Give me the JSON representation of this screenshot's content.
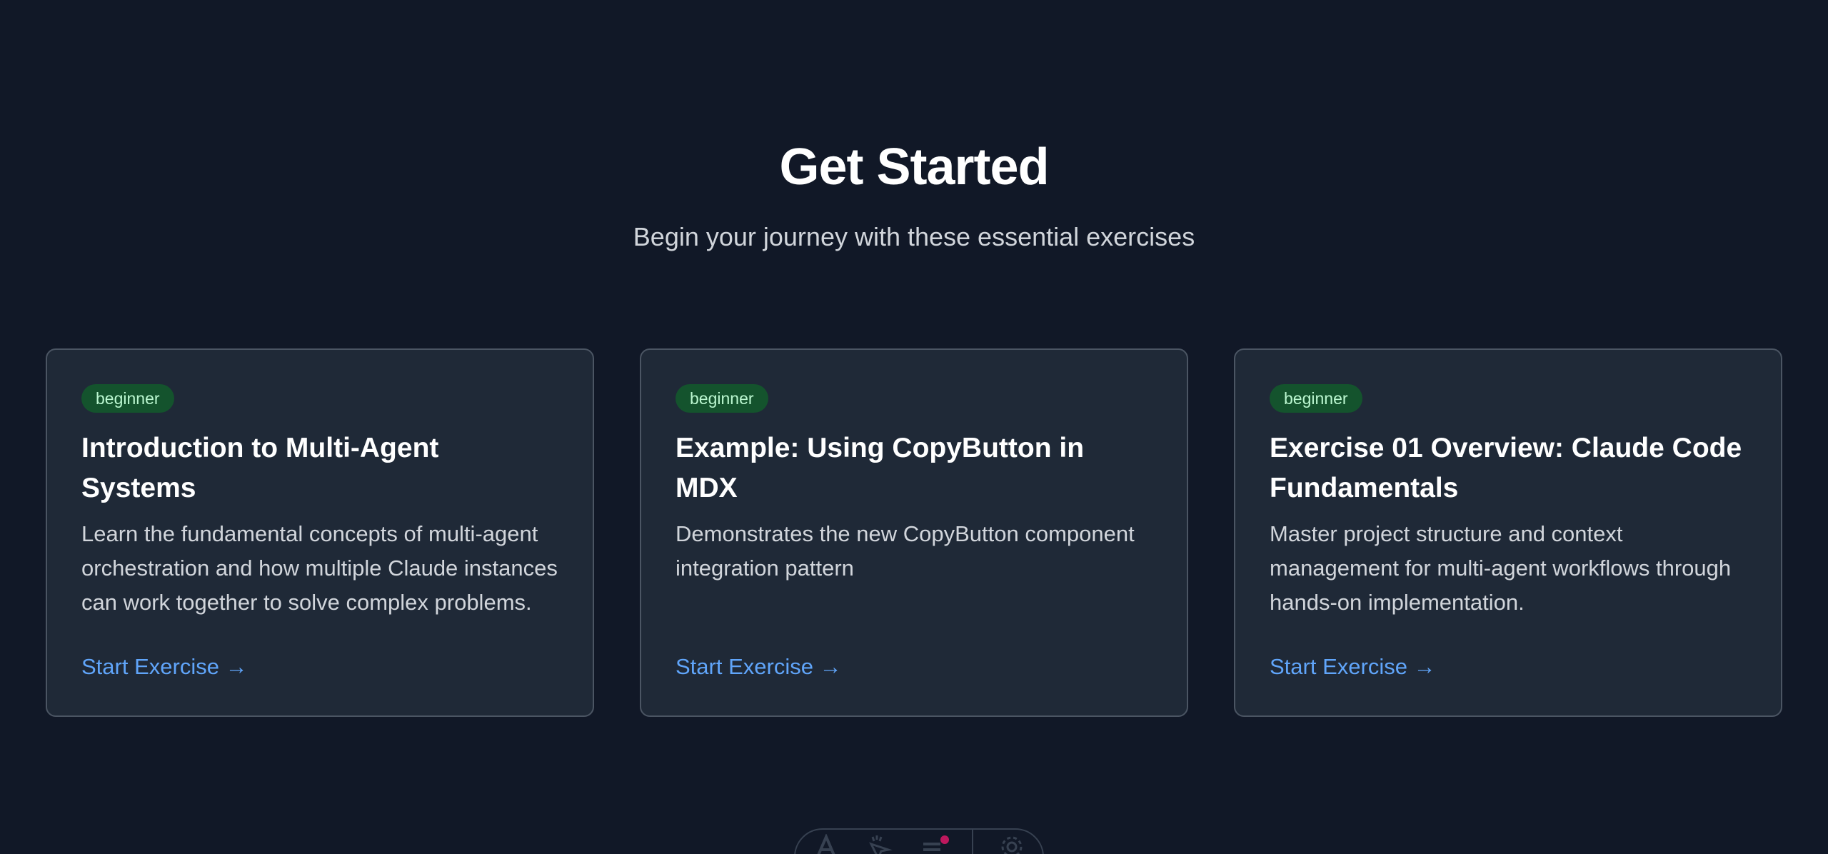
{
  "hero": {
    "title": "Get Started",
    "subtitle": "Begin your journey with these essential exercises"
  },
  "cards": [
    {
      "badge": "beginner",
      "title": "Introduction to Multi-Agent Systems",
      "description": "Learn the fundamental concepts of multi-agent orchestration and how multiple Claude instances can work together to solve complex problems.",
      "link": "Start Exercise →"
    },
    {
      "badge": "beginner",
      "title": "Example: Using CopyButton in MDX",
      "description": "Demonstrates the new CopyButton component integration pattern",
      "link": "Start Exercise →"
    },
    {
      "badge": "beginner",
      "title": "Exercise 01 Overview: Claude Code Fundamentals",
      "description": "Master project structure and context management for multi-agent workflows through hands-on implementation.",
      "link": "Start Exercise →"
    }
  ],
  "toolbar": {
    "icons": [
      "text-icon",
      "pointer-icon",
      "menu-icon",
      "settings-icon"
    ]
  },
  "colors": {
    "background": "#111827",
    "card": "#1f2937",
    "badge_bg": "#14532d",
    "badge_text": "#bbf7d0",
    "link": "#60a5fa"
  }
}
